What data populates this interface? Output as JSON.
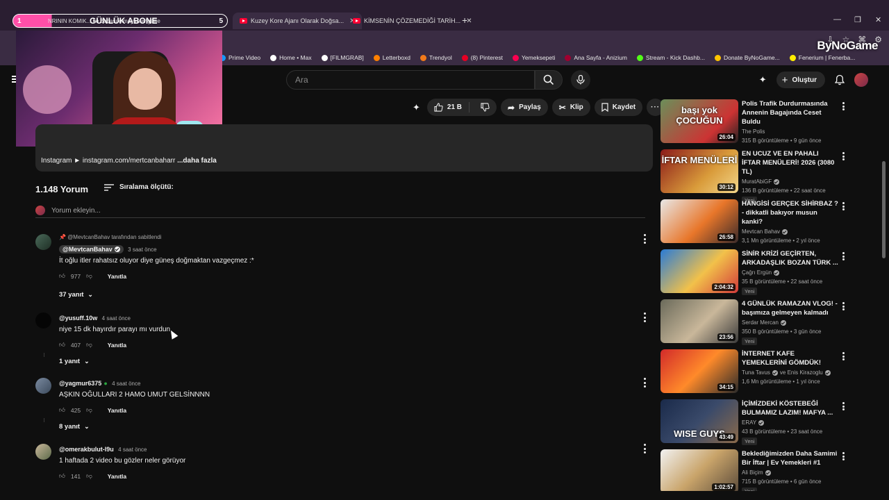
{
  "browser": {
    "tabs": [
      {
        "label": "NRININ KOMIK... he babası olmayan engellie"
      },
      {
        "label": "Kuzey Kore Ajanı Olarak Doğsa..."
      },
      {
        "label": "KİMSENİN ÇÖZEMEDİĞİ TARİH..."
      }
    ],
    "bookmarks": [
      {
        "label": "Prime Video",
        "color": "#1399ff"
      },
      {
        "label": "Home • Max",
        "color": "#ffffff"
      },
      {
        "label": "[FILMGRAB]",
        "color": "#ffffff"
      },
      {
        "label": "Letterboxd",
        "color": "#ff8000"
      },
      {
        "label": "Trendyol",
        "color": "#f27a1a"
      },
      {
        "label": "(8) Pinterest",
        "color": "#e60023"
      },
      {
        "label": "Yemeksepeti",
        "color": "#fa0050"
      },
      {
        "label": "Ana Sayfa - Anizium",
        "color": "#a00030"
      },
      {
        "label": "Stream - Kick Dashb...",
        "color": "#53fc18"
      },
      {
        "label": "Donate ByNoGame...",
        "color": "#ffc400"
      },
      {
        "label": "Fenerium | Fenerba...",
        "color": "#ffed00"
      }
    ],
    "brand": "ByNoGame"
  },
  "overlay": {
    "goal_start": "1",
    "goal_title": "GÜNLÜK ABONE",
    "goal_end": "5",
    "goal_progress": 0.18
  },
  "header": {
    "search_placeholder": "Ara",
    "create_label": "Oluştur"
  },
  "actions": {
    "likes": "21 B",
    "share": "Paylaş",
    "clip": "Klip",
    "save": "Kaydet"
  },
  "description": {
    "text": "Instagram ► instagram.com/mertcanbaharr ",
    "more": "...daha fazla"
  },
  "comments_section": {
    "count": "1.148 Yorum",
    "sort_label": "Sıralama ölçütü:",
    "add_placeholder": "Yorum ekleyin...",
    "reply_label": "Yanıtla",
    "items": [
      {
        "pinned": "@MevtcanBahav tarafından sabitlendi",
        "author": "@MevtcanBahav",
        "time": "3 saat önce",
        "text": "İt oğlu itler rahatsız oluyor diye güneş doğmaktan vazgeçmez :*",
        "likes": "977",
        "replies": "37 yanıt"
      },
      {
        "author": "@yusuff.10w",
        "time": "4 saat önce",
        "text": "niye 15 dk hayırdır parayı mı vurdun",
        "likes": "407",
        "replies": "1 yanıt"
      },
      {
        "author": "@yagmur6375",
        "time": "4 saat önce",
        "text": "AŞKIN OĞULLARI 2 HAMO UMUT GELSİNNNN",
        "likes": "425",
        "replies": "8 yanıt"
      },
      {
        "author": "@omerakbulut-l9u",
        "time": "4 saat önce",
        "text": "1 haftada 2 video bu gözler neler görüyor",
        "likes": "141"
      }
    ]
  },
  "recommendations": [
    {
      "title": "Polis Trafik Durdurmasında Annenin Bagajında Ceset Buldu",
      "channel": "The Polis",
      "stats": "315 B görüntüleme • 9 gün önce",
      "duration": "26:04",
      "caption": "başı yok ÇOCUĞUN",
      "new": ""
    },
    {
      "title": "EN UCUZ VE EN PAHALI İFTAR MENÜLERİ! 2026 (3080 TL)",
      "channel": "MuratAbiGF",
      "stats": "136 B görüntüleme • 22 saat önce",
      "duration": "30:12",
      "caption": "İFTAR MENÜLERİ",
      "new": "Yeni"
    },
    {
      "title": "HANGİSİ GERÇEK SİHİRBAZ ? - dikkatli bakıyor musun kanki?",
      "channel": "Mevtcan Bahav",
      "stats": "3,1 Mn görüntüleme • 2 yıl önce",
      "duration": "26:58",
      "caption": "",
      "new": ""
    },
    {
      "title": "SİNİR KRİZİ GEÇİRTEN, ARKADAŞLIK BOZAN TÜRK ...",
      "channel": "Çağrı Ergün",
      "stats": "35 B görüntüleme • 22 saat önce",
      "duration": "2:04:32",
      "caption": "",
      "new": "Yeni"
    },
    {
      "title": "4 GÜNLÜK RAMAZAN VLOG! - başımıza gelmeyen kalmadı",
      "channel": "Serdar Mercan",
      "stats": "350 B görüntüleme • 3 gün önce",
      "duration": "23:56",
      "caption": "",
      "new": "Yeni"
    },
    {
      "title": "İNTERNET KAFE YEMEKLERİNİ GÖMDÜK!",
      "channel": "Tuna Tavus",
      "channel_extra": "ve Enis Kirazoglu",
      "stats": "1,6 Mn görüntüleme • 1 yıl önce",
      "duration": "34:15",
      "caption": "",
      "new": ""
    },
    {
      "title": "İÇİMİZDEKİ KÖSTEBEĞİ BULMAMIZ LAZIM! MAFYA ...",
      "channel": "ERAY",
      "stats": "43 B görüntüleme • 23 saat önce",
      "duration": "43:49",
      "caption": "WISE GUYS",
      "new": "Yeni"
    },
    {
      "title": "Beklediğimizden Daha Samimi Bir İftar | Ev Yemekleri #1",
      "channel": "Ali Biçim",
      "stats": "715 B görüntüleme • 6 gün önce",
      "duration": "1:02:57",
      "caption": "",
      "new": "Yeni"
    }
  ]
}
